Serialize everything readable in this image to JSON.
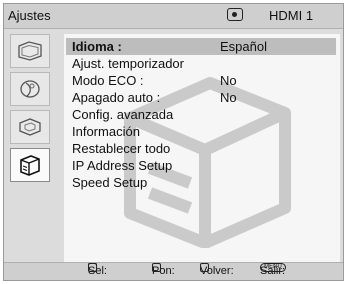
{
  "header": {
    "title": "Ajustes",
    "input_icon": "input-source-icon",
    "input_label": "HDMI 1"
  },
  "sidebar": {
    "tabs": [
      {
        "icon": "picture-settings-icon"
      },
      {
        "icon": "sound-settings-icon"
      },
      {
        "icon": "channel-settings-icon"
      },
      {
        "icon": "setup-toolbox-icon",
        "active": true
      }
    ]
  },
  "menu": {
    "items": [
      {
        "label": "Idioma :",
        "value": "Español",
        "selected": true
      },
      {
        "label": "Ajust. temporizador",
        "value": ""
      },
      {
        "label": "Modo ECO :",
        "value": "No"
      },
      {
        "label": "Apagado auto :",
        "value": "No"
      },
      {
        "label": "Config. avanzada",
        "value": ""
      },
      {
        "label": "Información",
        "value": ""
      },
      {
        "label": "Restablecer todo",
        "value": ""
      },
      {
        "label": "IP Address Setup",
        "value": ""
      },
      {
        "label": "Speed Setup",
        "value": ""
      }
    ]
  },
  "footer": {
    "sel_label": "Sel:",
    "pon_label": "Pon:",
    "volver_label": "Volver:",
    "salir_label": "Salir:",
    "menu_key": "MENU"
  },
  "watermark_icon": "setup-toolbox-icon"
}
